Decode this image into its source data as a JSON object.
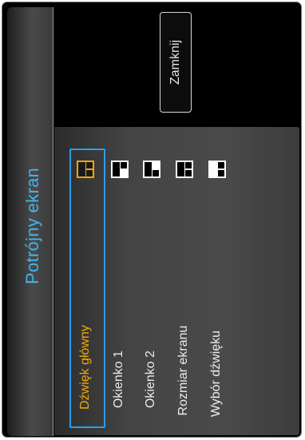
{
  "dialog": {
    "title": "Potrójny ekran",
    "close_label": "Zamknij"
  },
  "menu": {
    "items": [
      {
        "label": "Dźwięk główny",
        "active": true
      },
      {
        "label": "Okienko 1",
        "active": false
      },
      {
        "label": "Okienko 2",
        "active": false
      },
      {
        "label": "Rozmiar ekranu",
        "active": false
      },
      {
        "label": "Wybór dźwięku",
        "active": false
      }
    ]
  },
  "layouts": [
    {
      "icon": "layout-main-sound-icon",
      "selected": true
    },
    {
      "icon": "layout-window-1-icon",
      "selected": false
    },
    {
      "icon": "layout-window-2-icon",
      "selected": false
    },
    {
      "icon": "layout-screen-size-icon",
      "selected": false
    },
    {
      "icon": "layout-sound-select-icon",
      "selected": false
    }
  ],
  "colors": {
    "title": "#3fb4ef",
    "active_item": "#f5a800",
    "selection_border": "#2aa0e8"
  }
}
